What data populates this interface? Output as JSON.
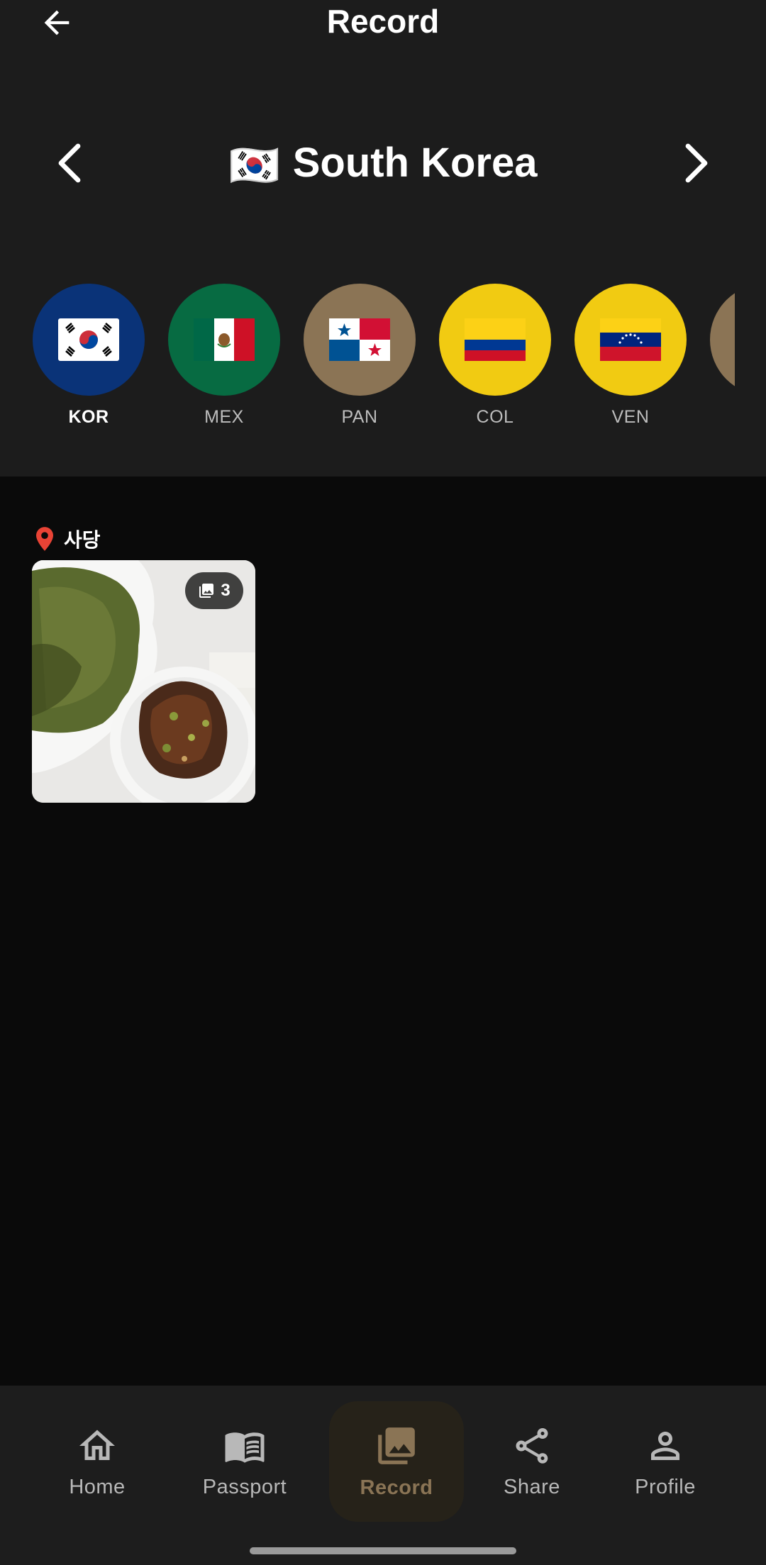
{
  "app_bar": {
    "title": "Record"
  },
  "country_selector": {
    "flag_emoji": "🇰🇷",
    "name": "South Korea"
  },
  "flags": [
    {
      "code": "KOR",
      "active": true,
      "bg": "#0a3378"
    },
    {
      "code": "MEX",
      "active": false,
      "bg": "#076b42"
    },
    {
      "code": "PAN",
      "active": false,
      "bg": "#8b7455"
    },
    {
      "code": "COL",
      "active": false,
      "bg": "#f1cb12"
    },
    {
      "code": "VEN",
      "active": false,
      "bg": "#f1cb12"
    }
  ],
  "record": {
    "location": "사당",
    "photo_count": "3"
  },
  "bottom_nav": {
    "items": [
      {
        "label": "Home",
        "icon": "home-icon"
      },
      {
        "label": "Passport",
        "icon": "book-icon"
      },
      {
        "label": "Record",
        "icon": "photo-library-icon",
        "active": true
      },
      {
        "label": "Share",
        "icon": "share-icon"
      },
      {
        "label": "Profile",
        "icon": "person-icon"
      }
    ]
  },
  "colors": {
    "accent": "#8a7455",
    "location_pin": "#e94335",
    "background": "#0a0a0a",
    "header": "#1c1c1c"
  }
}
